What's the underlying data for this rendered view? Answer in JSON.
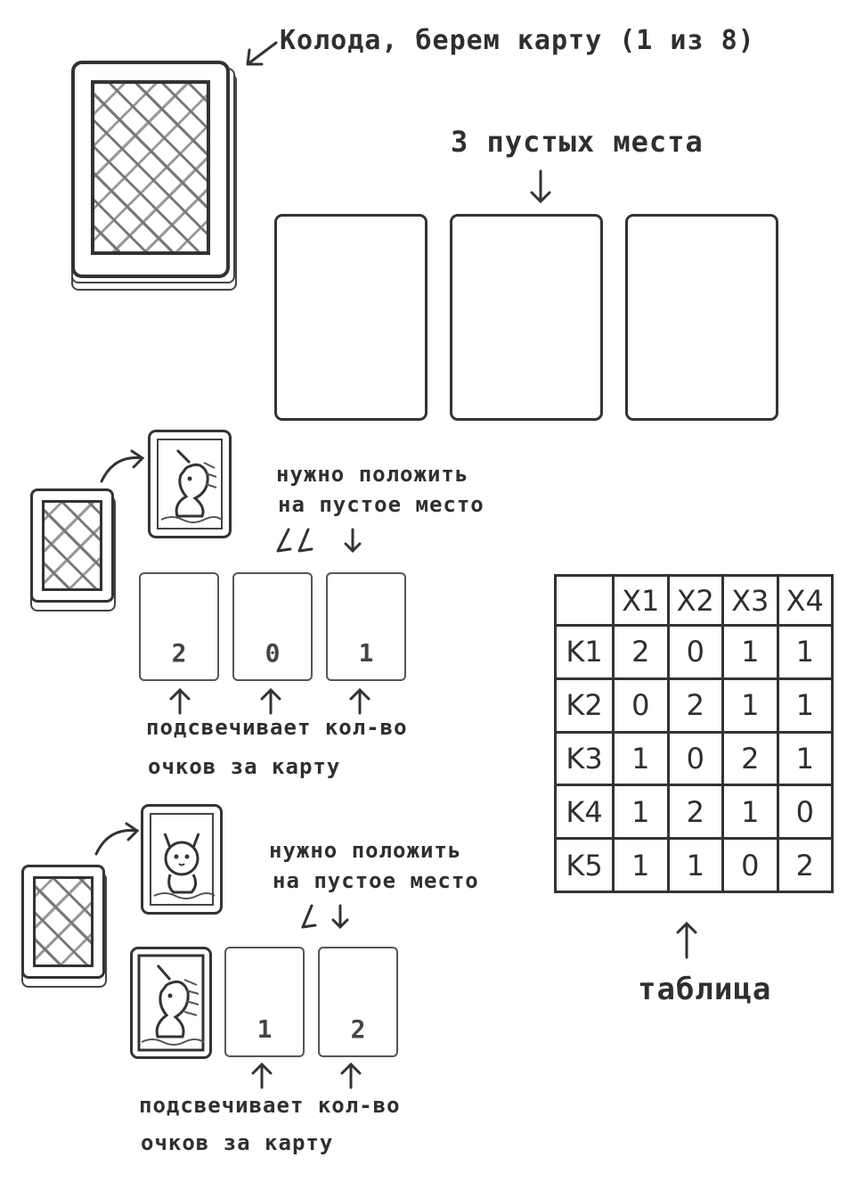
{
  "labels": {
    "deck_note": "Колода, берем карту (1 из 8)",
    "empty_slots": "3 пустых места",
    "place_line1": "нужно положить",
    "place_line2": "на пустое место",
    "highlight_line1": "подсвечивает кол-во",
    "highlight_line2": "очков за карту",
    "place2_line1": "нужно положить",
    "place2_line2": "на пустое место",
    "highlight2_line1": "подсвечивает кол-во",
    "highlight2_line2": "очков за карту",
    "table_caption": "таблица"
  },
  "scores_row1": [
    "2",
    "0",
    "1"
  ],
  "scores_row2": [
    "1",
    "2"
  ],
  "table": {
    "columns": [
      "X1",
      "X2",
      "X3",
      "X4"
    ],
    "rows": [
      {
        "label": "K1",
        "cells": [
          "2",
          "0",
          "1",
          "1"
        ]
      },
      {
        "label": "K2",
        "cells": [
          "0",
          "2",
          "1",
          "1"
        ]
      },
      {
        "label": "K3",
        "cells": [
          "1",
          "0",
          "2",
          "1"
        ]
      },
      {
        "label": "K4",
        "cells": [
          "1",
          "2",
          "1",
          "0"
        ]
      },
      {
        "label": "K5",
        "cells": [
          "1",
          "1",
          "0",
          "2"
        ]
      }
    ]
  }
}
